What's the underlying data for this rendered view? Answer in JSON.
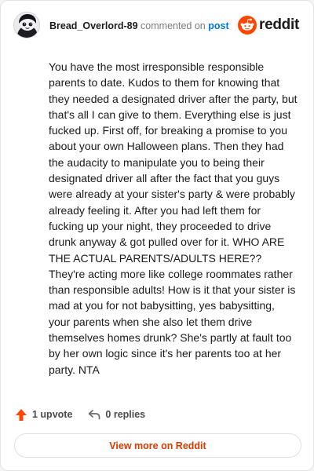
{
  "header": {
    "username": "Bread_Overlord-89",
    "commented_on": "commented on",
    "post_link": "post",
    "brand": "reddit",
    "avatar_icon": "snoo-avatar-icon",
    "brand_icon": "reddit-logo-icon"
  },
  "comment": {
    "body": "You have the most irresponsible responsible parents to date. Kudos to them for knowing that they needed a designated driver after the party, but that's all I can give to them. Everything else is just fucked up. First off, for breaking a promise to you about your own Halloween plans. Then they had the audacity to manipulate you to being their designated driver all after the fact that you guys were already at your sister's party & were probably already feeling it. After you had left them for fucking up your night, they proceeded to drive drunk anyway & got pulled over for it. WHO ARE THE ACTUAL PARENTS/ADULTS HERE?? They're acting more like college roommates rather than responsible adults! How is it that your sister is mad at you for not babysitting, yes babysitting, your parents when she also let them drive themselves homes drunk? She's partly at fault too by her own logic since it's her parents too at her party. NTA"
  },
  "actions": {
    "upvote_label": "1 upvote",
    "upvote_icon": "upvote-arrow-icon",
    "reply_label": "0 replies",
    "reply_icon": "reply-arrow-icon"
  },
  "footer": {
    "view_more_label": "View more on Reddit"
  },
  "colors": {
    "brand_orange": "#ff4500",
    "link_blue": "#0079d3",
    "cta_text": "#d93a00"
  }
}
